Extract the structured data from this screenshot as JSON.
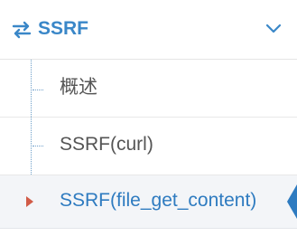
{
  "menu": {
    "header": {
      "title": "SSRF",
      "icon": "swap-arrows-icon",
      "expand_icon": "chevron-down-icon",
      "color": "#3a87c8"
    },
    "items": [
      {
        "label": "概述"
      },
      {
        "label": "SSRF(curl)"
      },
      {
        "label": "SSRF(file_get_content)",
        "active": true
      }
    ],
    "accent_active_arrow": "#d15b47",
    "accent_active_text": "#2e7bc0"
  }
}
